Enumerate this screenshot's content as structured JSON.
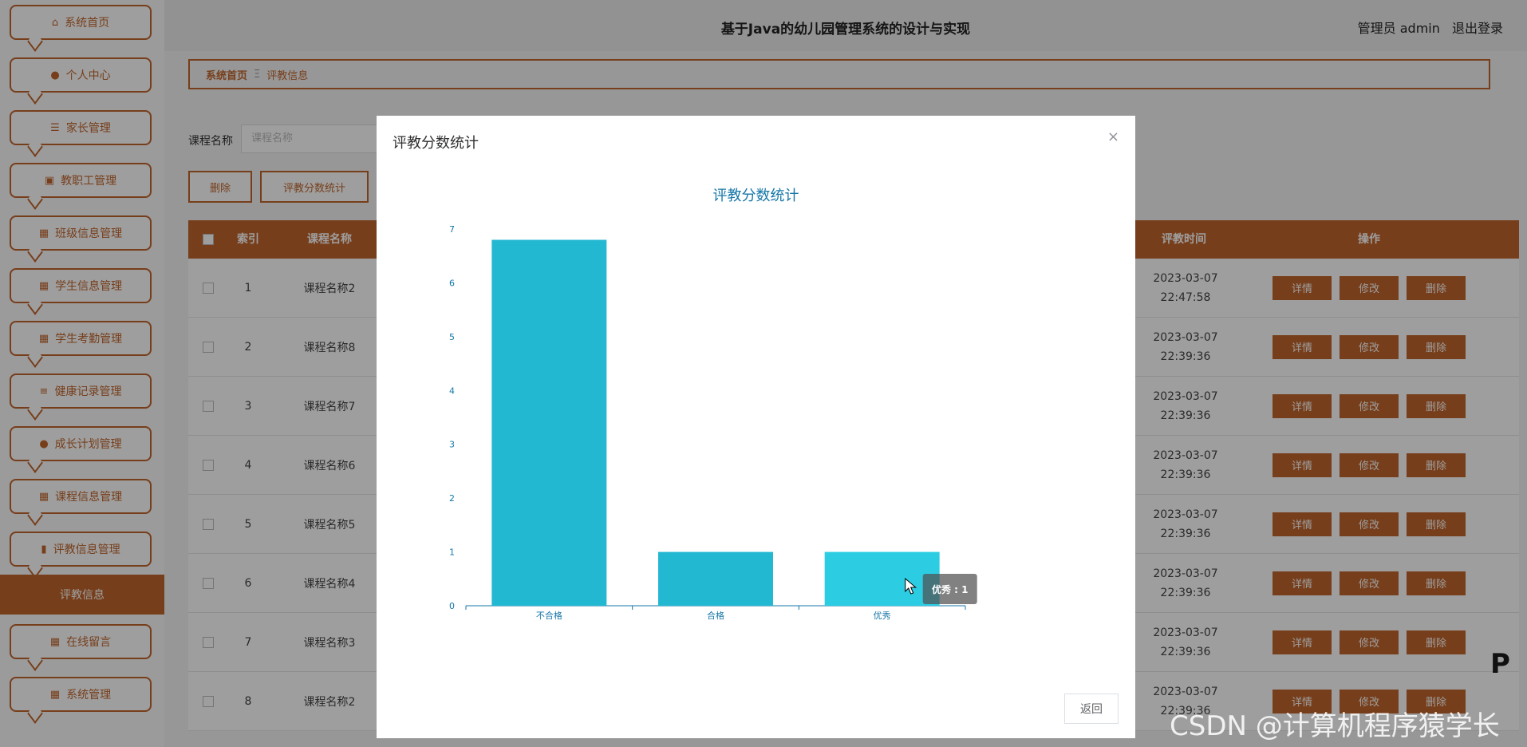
{
  "sidebar": {
    "items": [
      {
        "label": "系统首页",
        "icon": "home-icon"
      },
      {
        "label": "个人中心",
        "icon": "user-icon"
      },
      {
        "label": "家长管理",
        "icon": "list-icon"
      },
      {
        "label": "教职工管理",
        "icon": "briefcase-icon"
      },
      {
        "label": "班级信息管理",
        "icon": "grid-icon"
      },
      {
        "label": "学生信息管理",
        "icon": "grid-icon"
      },
      {
        "label": "学生考勤管理",
        "icon": "grid-icon"
      },
      {
        "label": "健康记录管理",
        "icon": "sliders-icon"
      },
      {
        "label": "成长计划管理",
        "icon": "user-icon"
      },
      {
        "label": "课程信息管理",
        "icon": "grid-icon"
      },
      {
        "label": "评教信息管理",
        "icon": "bar-chart-icon"
      },
      {
        "label": "在线留言",
        "icon": "grid-icon"
      },
      {
        "label": "系统管理",
        "icon": "grid-icon"
      }
    ],
    "active_item": "评教信息"
  },
  "header": {
    "title": "基于Java的幼儿园管理系统的设计与实现",
    "user_label": "管理员 admin",
    "logout": "退出登录"
  },
  "breadcrumb": {
    "home": "系统首页",
    "separator": "Ξ",
    "current": "评教信息"
  },
  "search": {
    "label": "课程名称",
    "placeholder": "课程名称"
  },
  "actions": {
    "delete": "删除",
    "stats": "评教分数统计"
  },
  "table": {
    "headers": {
      "index": "索引",
      "course": "课程名称",
      "time": "评教时间",
      "ops": "操作"
    },
    "row_buttons": {
      "detail": "详情",
      "edit": "修改",
      "delete": "删除"
    },
    "rows": [
      {
        "index": "1",
        "course": "课程名称2",
        "time": "2023-03-07 22:47:58"
      },
      {
        "index": "2",
        "course": "课程名称8",
        "time": "2023-03-07 22:39:36"
      },
      {
        "index": "3",
        "course": "课程名称7",
        "time": "2023-03-07 22:39:36"
      },
      {
        "index": "4",
        "course": "课程名称6",
        "time": "2023-03-07 22:39:36"
      },
      {
        "index": "5",
        "course": "课程名称5",
        "time": "2023-03-07 22:39:36"
      },
      {
        "index": "6",
        "course": "课程名称4",
        "time": "2023-03-07 22:39:36"
      },
      {
        "index": "7",
        "course": "课程名称3",
        "time": "2023-03-07 22:39:36"
      },
      {
        "index": "8",
        "course": "课程名称2",
        "time": "2023-03-07 22:39:36"
      }
    ]
  },
  "dialog": {
    "title": "评教分数统计",
    "close": "×",
    "return_button": "返回"
  },
  "chart_data": {
    "type": "bar",
    "title": "评教分数统计",
    "categories": [
      "不合格",
      "合格",
      "优秀"
    ],
    "values": [
      6.8,
      1,
      1
    ],
    "ylim": [
      0,
      7
    ],
    "yticks": [
      0,
      1,
      2,
      3,
      4,
      5,
      6,
      7
    ],
    "xlabel": "",
    "ylabel": "",
    "grid": false,
    "tooltip": "优秀 : 1",
    "colors": {
      "bar": "#22b8d2",
      "bar_hover": "#2ccde3",
      "axis": "#1677a8"
    }
  },
  "colors": {
    "accent": "#c0652c"
  },
  "watermark": "CSDN @计算机程序猿学长",
  "edge_glyph": "P"
}
